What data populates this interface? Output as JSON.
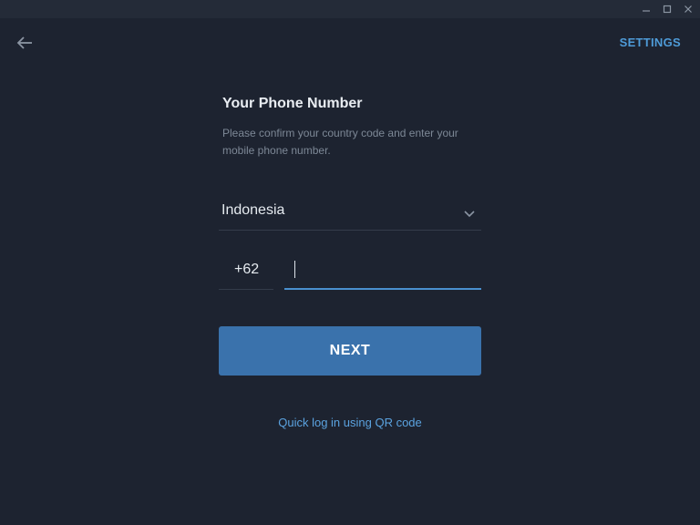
{
  "titlebar": {
    "minimize_icon": "minimize-icon",
    "maximize_icon": "maximize-icon",
    "close_icon": "close-icon"
  },
  "header": {
    "back_icon": "arrow-left-icon",
    "settings_label": "SETTINGS"
  },
  "form": {
    "title": "Your Phone Number",
    "description": "Please confirm your country code and enter your mobile phone number.",
    "country": {
      "selected": "Indonesia",
      "chevron_icon": "chevron-down-icon"
    },
    "code": "+62",
    "phone": {
      "value": "",
      "placeholder": ""
    },
    "next_label": "NEXT",
    "qr_link_label": "Quick log in using QR code"
  },
  "colors": {
    "background": "#1d2330",
    "titlebar": "#242b38",
    "accent": "#3a72ac",
    "link": "#5ba3e0",
    "input_focus": "#4a8fce"
  }
}
